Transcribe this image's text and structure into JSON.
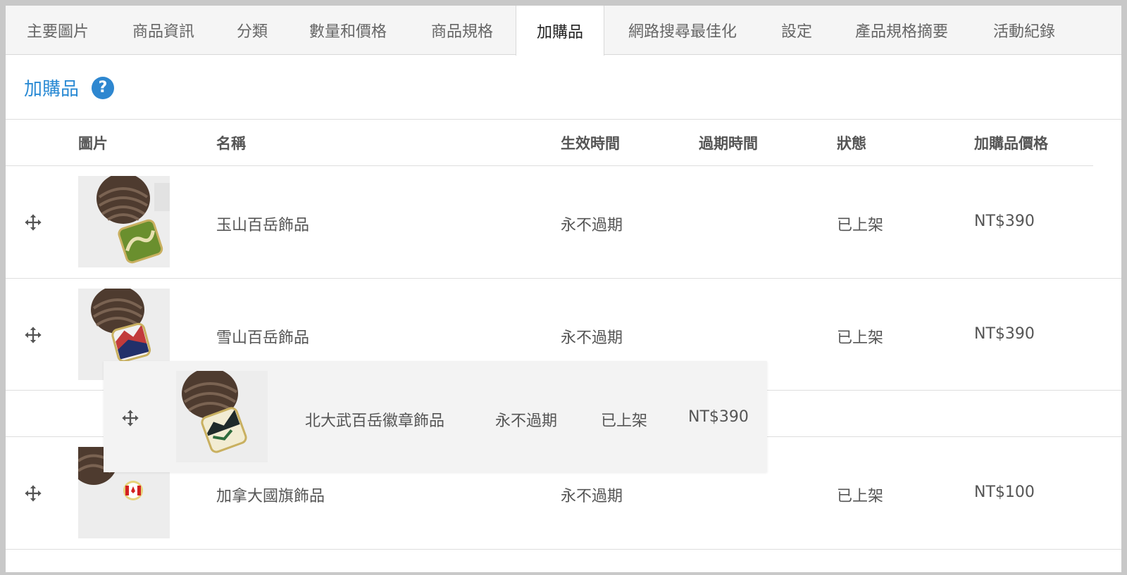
{
  "tabs": [
    {
      "label": "主要圖片"
    },
    {
      "label": "商品資訊"
    },
    {
      "label": "分類"
    },
    {
      "label": "數量和價格"
    },
    {
      "label": "商品規格"
    },
    {
      "label": "加購品"
    },
    {
      "label": "網路搜尋最佳化"
    },
    {
      "label": "設定"
    },
    {
      "label": "產品規格摘要"
    },
    {
      "label": "活動紀錄"
    }
  ],
  "active_tab": "加購品",
  "section": {
    "title": "加購品",
    "help_icon": "question-circle-icon"
  },
  "table": {
    "headers": {
      "image": "圖片",
      "name": "名稱",
      "start": "生效時間",
      "expire": "過期時間",
      "status": "狀態",
      "price": "加購品價格"
    },
    "rows": [
      {
        "name": "玉山百岳飾品",
        "start": "永不過期",
        "expire": "",
        "status": "已上架",
        "price": "NT$390"
      },
      {
        "name": "雪山百岳飾品",
        "start": "永不過期",
        "expire": "",
        "status": "已上架",
        "price": "NT$390"
      },
      {
        "name": "加拿大國旗飾品",
        "start": "永不過期",
        "expire": "",
        "status": "已上架",
        "price": "NT$100"
      }
    ],
    "dragging_row": {
      "name": "北大武百岳徽章飾品",
      "start": "永不過期",
      "status": "已上架",
      "price": "NT$390"
    }
  },
  "colors": {
    "accent": "#2a8ad4",
    "help_icon": "#2e87d0",
    "tab_bar": "#f5f5f5",
    "drag_row": "#f3f3f3"
  }
}
